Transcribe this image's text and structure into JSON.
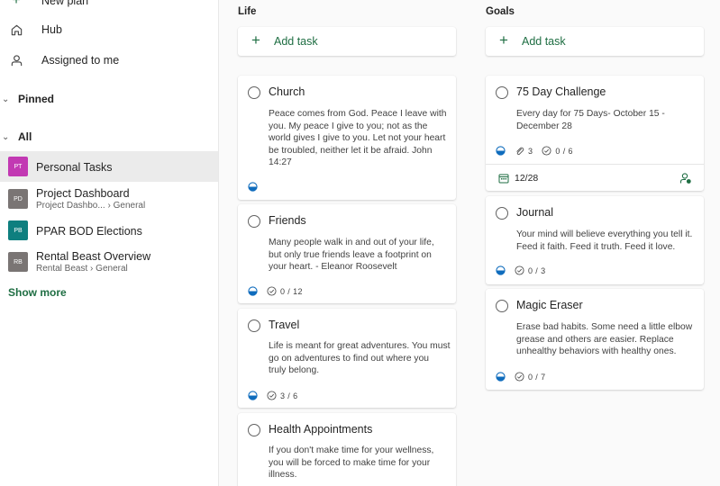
{
  "sidebar": {
    "new_plan": "New plan",
    "hub": "Hub",
    "assigned": "Assigned to me",
    "pinned": "Pinned",
    "all": "All",
    "plans": [
      {
        "initials": "PT",
        "name": "Personal Tasks",
        "color": "#c239b3"
      },
      {
        "initials": "PD",
        "name": "Project Dashboard",
        "sub_a": "Project Dashbo...",
        "sub_b": "General",
        "color": "#7a7574"
      },
      {
        "initials": "PB",
        "name": "PPAR BOD Elections",
        "color": "#0e7f7f"
      },
      {
        "initials": "RB",
        "name": "Rental Beast Overview",
        "sub_a": "Rental Beast",
        "sub_b": "General",
        "color": "#7a7574"
      }
    ],
    "show_more": "Show more"
  },
  "columns": [
    {
      "title": "Life",
      "add_task": "Add task",
      "cards": [
        {
          "title": "Church",
          "notes": [
            "Peace comes from God. Peace I leave with",
            "you. My peace I give to you; not as the",
            "world gives I give to you. Let not your heart",
            "be troubled, neither let it be afraid. John",
            "14:27"
          ]
        },
        {
          "title": "Friends",
          "notes": [
            "Many people walk in and out of your life,",
            "but only true friends leave a footprint on",
            "your heart. - Eleanor Roosevelt"
          ],
          "checklist": "0 / 12"
        },
        {
          "title": "Travel",
          "notes": [
            "Life is meant for great adventures. You must",
            "go on adventures to find out where you",
            "truly belong."
          ],
          "checklist": "3 / 6"
        },
        {
          "title": "Health Appointments",
          "notes": [
            "If you don't make time for your wellness,",
            "you will be forced to make time for your",
            "illness."
          ]
        }
      ]
    },
    {
      "title": "Goals",
      "add_task": "Add task",
      "cards": [
        {
          "title": "75 Day Challenge",
          "notes": [
            "Every day for 75 Days- October 15 -",
            "December 28"
          ],
          "attachments": "3",
          "checklist": "0 / 6",
          "due": "12/28"
        },
        {
          "title": "Journal",
          "notes": [
            "Your mind will believe everything you tell it.",
            "Feed it faith. Feed it truth. Feed it love."
          ],
          "checklist": "0 / 3"
        },
        {
          "title": "Magic Eraser",
          "notes": [
            "Erase bad habits. Some need a little elbow",
            "grease and others are easier. Replace",
            "unhealthy behaviors with healthy ones."
          ],
          "checklist": "0 / 7"
        }
      ]
    }
  ],
  "colors": {
    "accent": "#1f6e43",
    "progress": "#0f6cbd"
  },
  "icons": {
    "progress": "half-circle-progress-icon",
    "checklist": "check-circle-icon",
    "attachment": "paperclip-icon",
    "due": "calendar-icon"
  }
}
